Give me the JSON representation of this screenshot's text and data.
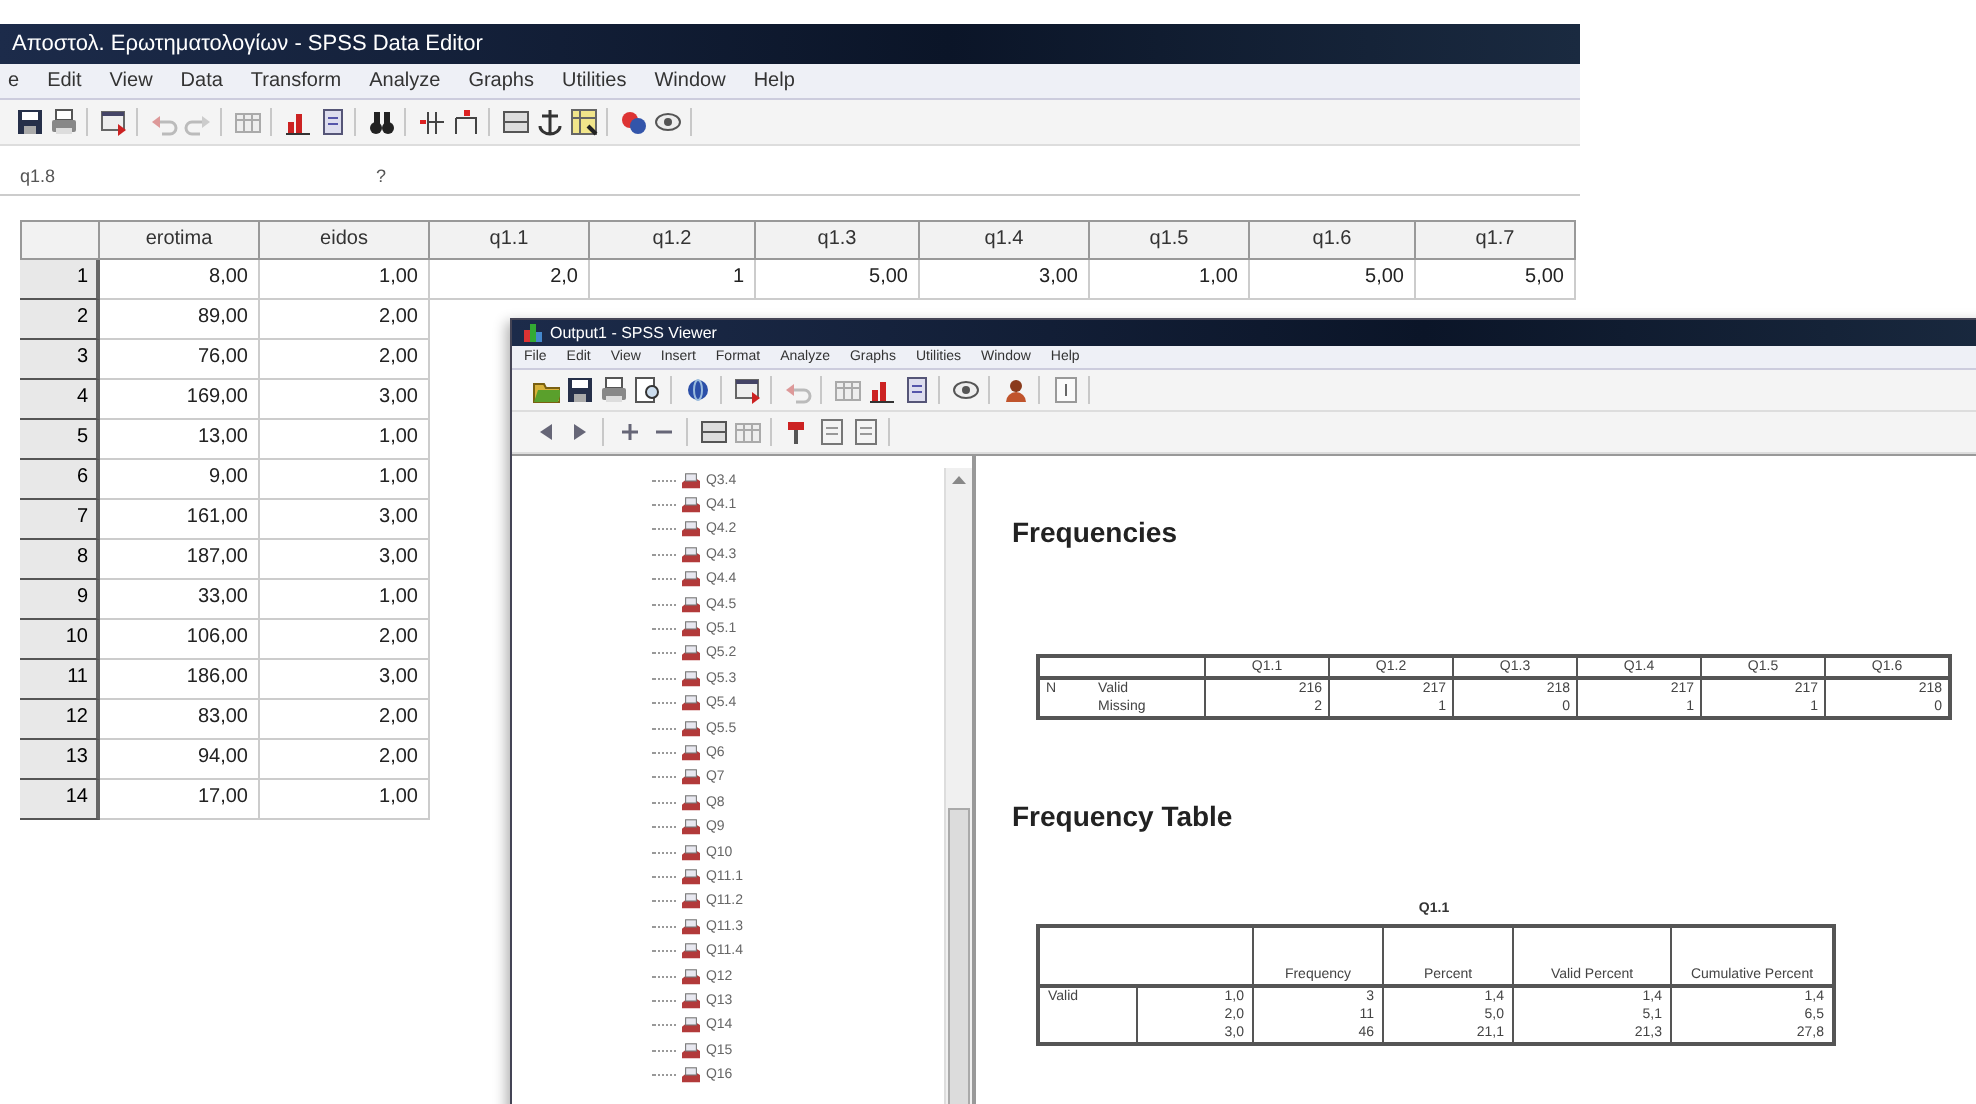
{
  "editor": {
    "title": "Αποστολ. Ερωτηματολογίων - SPSS Data Editor",
    "menu": [
      "e",
      "Edit",
      "View",
      "Data",
      "Transform",
      "Analyze",
      "Graphs",
      "Utilities",
      "Window",
      "Help"
    ],
    "cell_ref": "q1.8",
    "cell_value": "?",
    "columns": [
      "erotima",
      "eidos",
      "q1.1",
      "q1.2",
      "q1.3",
      "q1.4",
      "q1.5",
      "q1.6",
      "q1.7"
    ],
    "rows": [
      {
        "number": "1",
        "cells": [
          "8,00",
          "1,00",
          "2,0",
          "1",
          "5,00",
          "3,00",
          "1,00",
          "5,00",
          "5,00"
        ]
      },
      {
        "number": "2",
        "cells": [
          "89,00",
          "2,00"
        ]
      },
      {
        "number": "3",
        "cells": [
          "76,00",
          "2,00"
        ]
      },
      {
        "number": "4",
        "cells": [
          "169,00",
          "3,00"
        ]
      },
      {
        "number": "5",
        "cells": [
          "13,00",
          "1,00"
        ]
      },
      {
        "number": "6",
        "cells": [
          "9,00",
          "1,00"
        ]
      },
      {
        "number": "7",
        "cells": [
          "161,00",
          "3,00"
        ]
      },
      {
        "number": "8",
        "cells": [
          "187,00",
          "3,00"
        ]
      },
      {
        "number": "9",
        "cells": [
          "33,00",
          "1,00"
        ]
      },
      {
        "number": "10",
        "cells": [
          "106,00",
          "2,00"
        ]
      },
      {
        "number": "11",
        "cells": [
          "186,00",
          "3,00"
        ]
      },
      {
        "number": "12",
        "cells": [
          "83,00",
          "2,00"
        ]
      },
      {
        "number": "13",
        "cells": [
          "94,00",
          "2,00"
        ]
      },
      {
        "number": "14",
        "cells": [
          "17,00",
          "1,00"
        ]
      }
    ]
  },
  "viewer": {
    "title": "Output1 - SPSS Viewer",
    "menu": [
      "File",
      "Edit",
      "View",
      "Insert",
      "Format",
      "Analyze",
      "Graphs",
      "Utilities",
      "Window",
      "Help"
    ],
    "outline": [
      "Q3.4",
      "Q4.1",
      "Q4.2",
      "Q4.3",
      "Q4.4",
      "Q4.5",
      "Q5.1",
      "Q5.2",
      "Q5.3",
      "Q5.4",
      "Q5.5",
      "Q6",
      "Q7",
      "Q8",
      "Q9",
      "Q10",
      "Q11.1",
      "Q11.2",
      "Q11.3",
      "Q11.4",
      "Q12",
      "Q13",
      "Q14",
      "Q15",
      "Q16"
    ],
    "heading": "Frequencies",
    "statistics": {
      "columns": [
        "Q1.1",
        "Q1.2",
        "Q1.3",
        "Q1.4",
        "Q1.5",
        "Q1.6"
      ],
      "rows": [
        {
          "group": "N",
          "label": "Valid",
          "values": [
            "216",
            "217",
            "218",
            "217",
            "217",
            "218"
          ]
        },
        {
          "label": "Missing",
          "values": [
            "2",
            "1",
            "0",
            "1",
            "1",
            "0"
          ]
        }
      ]
    },
    "table_heading": "Frequency Table",
    "frequency": {
      "caption": "Q1.1",
      "columns": [
        "Frequency",
        "Percent",
        "Valid Percent",
        "Cumulative Percent"
      ],
      "rows": [
        {
          "group": "Valid",
          "label": "1,0",
          "values": [
            "3",
            "1,4",
            "1,4",
            "1,4"
          ]
        },
        {
          "label": "2,0",
          "values": [
            "11",
            "5,0",
            "5,1",
            "6,5"
          ]
        },
        {
          "label": "3,0",
          "values": [
            "46",
            "21,1",
            "21,3",
            "27,8"
          ]
        }
      ]
    }
  }
}
